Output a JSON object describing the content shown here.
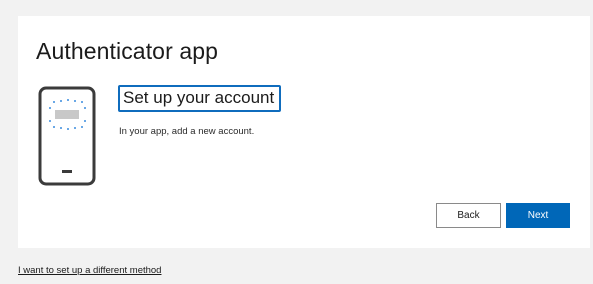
{
  "dialog": {
    "title": "Authenticator app",
    "illustration_icon": "phone-with-app-icon",
    "step_heading": "Set up your account",
    "step_description": "In your app, add a new account.",
    "back_label": "Back",
    "next_label": "Next"
  },
  "footer": {
    "alt_method_link": "I want to set up a different method"
  },
  "colors": {
    "primary_button": "#0067b8",
    "focus_outline": "#0f6cbd",
    "page_background": "#f2f2f2",
    "card_background": "#ffffff"
  }
}
